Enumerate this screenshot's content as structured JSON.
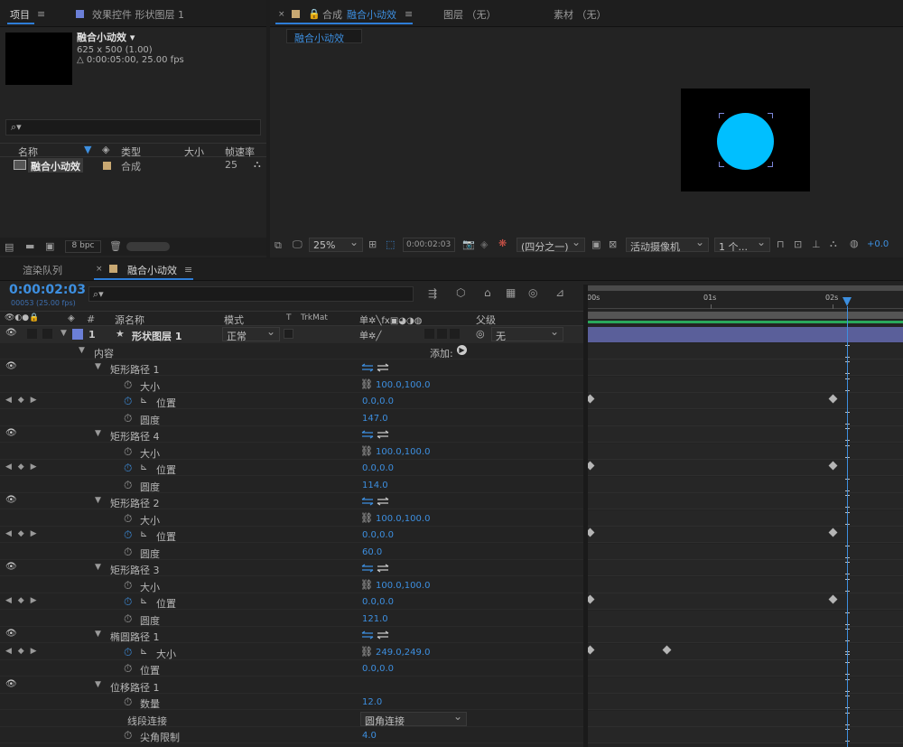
{
  "project_panel": {
    "tab_project": "项目",
    "tab_effects": "效果控件 形状图层 1",
    "comp_name": "融合小动效",
    "comp_size": "625 x 500 (1.00)",
    "comp_duration": "△ 0:00:05:00, 25.00 fps",
    "columns": {
      "name": "名称",
      "type": "类型",
      "size": "大小",
      "fps": "帧速率"
    },
    "item": {
      "name": "融合小动效",
      "type": "合成",
      "fps": "25"
    },
    "bpc": "8 bpc"
  },
  "viewer": {
    "tab_comp_prefix": "合成",
    "tab_comp_name": "融合小动效",
    "tab_layer": "图层 （无）",
    "tab_footage": "素材 （无）",
    "breadcrumb": "融合小动效",
    "zoom": "25%",
    "timecode": "0:00:02:03",
    "resolution": "(四分之一)",
    "camera": "活动摄像机",
    "views": "1 个...",
    "exposure": "+0.0",
    "circle_color": "#00bfff"
  },
  "timeline": {
    "tab_render": "渲染队列",
    "tab_comp": "融合小动效",
    "timecode": "0:00:02:03",
    "frame_info": "00053 (25.00 fps)",
    "ruler": [
      "00s",
      "01s",
      "02s"
    ],
    "headers": {
      "hash": "#",
      "source": "源名称",
      "mode": "模式",
      "t": "T",
      "trkmat": "TrkMat",
      "parent": "父级"
    },
    "layer": {
      "num": "1",
      "name": "形状图层 1",
      "mode": "正常",
      "parent": "无",
      "color": "#6b7fd7"
    },
    "contents": "内容",
    "add": "添加:",
    "rows": [
      {
        "type": "group",
        "name": "矩形路径 1"
      },
      {
        "type": "prop",
        "name": "大小",
        "value": "100.0,100.0",
        "link": true
      },
      {
        "type": "kprop",
        "name": "位置",
        "value": "0.0,0.0"
      },
      {
        "type": "prop",
        "name": "圆度",
        "value": "147.0"
      },
      {
        "type": "group",
        "name": "矩形路径 4"
      },
      {
        "type": "prop",
        "name": "大小",
        "value": "100.0,100.0",
        "link": true
      },
      {
        "type": "kprop",
        "name": "位置",
        "value": "0.0,0.0"
      },
      {
        "type": "prop",
        "name": "圆度",
        "value": "114.0"
      },
      {
        "type": "group",
        "name": "矩形路径 2"
      },
      {
        "type": "prop",
        "name": "大小",
        "value": "100.0,100.0",
        "link": true
      },
      {
        "type": "kprop",
        "name": "位置",
        "value": "0.0,0.0"
      },
      {
        "type": "prop",
        "name": "圆度",
        "value": "60.0"
      },
      {
        "type": "group",
        "name": "矩形路径 3"
      },
      {
        "type": "prop",
        "name": "大小",
        "value": "100.0,100.0",
        "link": true
      },
      {
        "type": "kprop",
        "name": "位置",
        "value": "0.0,0.0"
      },
      {
        "type": "prop",
        "name": "圆度",
        "value": "121.0"
      },
      {
        "type": "group",
        "name": "椭圆路径 1"
      },
      {
        "type": "kprop",
        "name": "大小",
        "value": "249.0,249.0",
        "link": true
      },
      {
        "type": "prop",
        "name": "位置",
        "value": "0.0,0.0"
      },
      {
        "type": "group",
        "name": "位移路径 1",
        "noswap": true
      },
      {
        "type": "prop",
        "name": "数量",
        "value": "12.0"
      },
      {
        "type": "select",
        "name": "线段连接",
        "value": "圆角连接"
      },
      {
        "type": "prop",
        "name": "尖角限制",
        "value": "4.0"
      }
    ]
  }
}
